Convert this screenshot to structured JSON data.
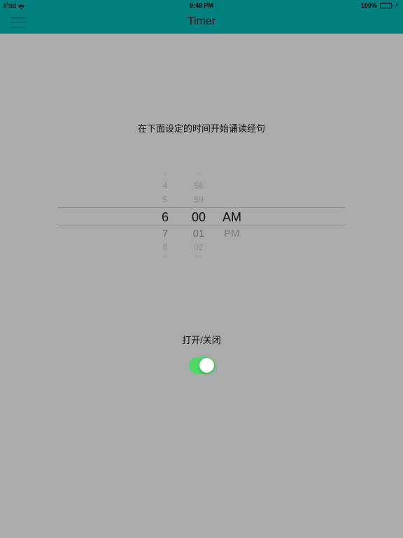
{
  "status_bar": {
    "device": "iPad",
    "time": "9:48 PM",
    "battery": "100%"
  },
  "nav": {
    "title": "Timer",
    "menu_icon": "hamburger-menu-icon"
  },
  "instruction": "在下面设定的时间开始诵读经句",
  "picker": {
    "hours": [
      "3",
      "4",
      "5",
      "6",
      "7",
      "8",
      "9"
    ],
    "minutes": [
      "57",
      "58",
      "59",
      "00",
      "01",
      "02",
      "03"
    ],
    "ampm": [
      "AM",
      "PM"
    ],
    "selected": {
      "hour": "6",
      "minute": "00",
      "ampm": "AM"
    }
  },
  "toggle": {
    "label": "打开/关闭",
    "on": true,
    "on_color": "#4dd964"
  },
  "colors": {
    "bar": "#007f7e",
    "background": "#ababab"
  }
}
